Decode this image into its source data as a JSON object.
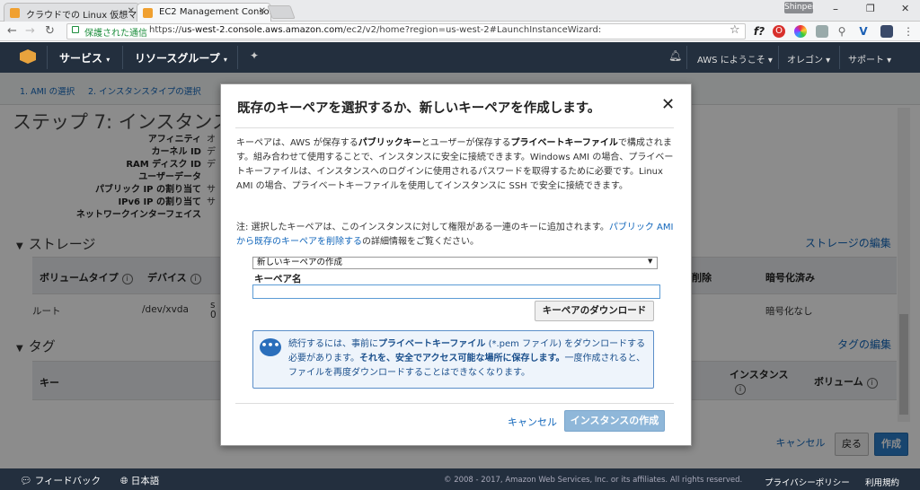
{
  "browser": {
    "tabs": [
      {
        "label": "クラウドでの Linux 仮想マシ"
      },
      {
        "label": "EC2 Management Console"
      }
    ],
    "profile": "Shinpei",
    "window_controls": [
      "–",
      "❐",
      "✕"
    ],
    "secure_label": "保護された通信",
    "url_prefix": "https://",
    "url_host": "us-west-2.console.aws.amazon.com",
    "url_path": "/ec2/v2/home?region=us-west-2#LaunchInstanceWizard:"
  },
  "aws_nav": {
    "services": "サービス",
    "resource_groups": "リソースグループ",
    "account": "AWS にようこそ",
    "region": "オレゴン",
    "support": "サポート"
  },
  "breadcrumbs": [
    "1. AMI の選択",
    "2. インスタンスタイプの選択"
  ],
  "page": {
    "step_title": "ステップ 7: インスタンス作成",
    "properties": [
      {
        "label": "アフィニティ",
        "value": "オ"
      },
      {
        "label": "カーネル ID",
        "value": "デ"
      },
      {
        "label": "RAM ディスク ID",
        "value": "デ"
      },
      {
        "label": "ユーザーデータ",
        "value": ""
      },
      {
        "label": "パブリック IP の割り当て",
        "value": "サ"
      },
      {
        "label": "IPv6 IP の割り当て",
        "value": "サ"
      },
      {
        "label": "ネットワークインターフェイス",
        "value": ""
      }
    ],
    "storage": {
      "heading": "ストレージ",
      "edit": "ストレージの編集",
      "columns": [
        "ボリュームタイプ",
        "デバイス",
        "削除",
        "暗号化済み"
      ],
      "row": {
        "type": "ルート",
        "device": "/dev/xvda",
        "snapshot_a": "s",
        "snapshot_b": "0",
        "encrypted": "暗号化なし"
      }
    },
    "tags": {
      "heading": "タグ",
      "edit": "タグの編集",
      "columns": [
        "キー",
        "インスタンス",
        "ボリューム"
      ]
    },
    "buttons": {
      "cancel": "キャンセル",
      "back": "戻る",
      "launch": "作成"
    }
  },
  "footer": {
    "feedback": "フィードバック",
    "language": "日本語",
    "copyright": "© 2008 - 2017, Amazon Web Services, Inc. or its affiliates. All rights reserved.",
    "privacy": "プライバシーポリシー",
    "terms": "利用規約"
  },
  "modal": {
    "title": "既存のキーペアを選択するか、新しいキーペアを作成します。",
    "p1_a": "キーペアは、AWS が保存する",
    "p1_b": "パブリックキー",
    "p1_c": "とユーザーが保存する",
    "p1_d": "プライベートキーファイル",
    "p1_e": "で構成されます。組み合わせて使用することで、インスタンスに安全に接続できます。Windows AMI の場合、プライベートキーファイルは、インスタンスへのログインに使用されるパスワードを取得するために必要です。Linux AMI の場合、プライベートキーファイルを使用してインスタンスに SSH で安全に接続できます。",
    "p2_a": "注: 選択したキーペアは、このインスタンスに対して権限がある一連のキーに追加されます。",
    "p2_link": "パブリック AMI から既存のキーペアを削除する",
    "p2_b": "の詳細情報をご覧ください。",
    "select_value": "新しいキーペアの作成",
    "keypair_label": "キーペア名",
    "keypair_value": "",
    "download_button": "キーペアのダウンロード",
    "notice_a": "続行するには、事前に",
    "notice_b": "プライベートキーファイル",
    "notice_c": " (*.pem ファイル) をダウンロードする必要があります。",
    "notice_d": "それを、安全でアクセス可能な場所に保存します。",
    "notice_e": "一度作成されると、ファイルを再度ダウンロードすることはできなくなります。",
    "cancel": "キャンセル",
    "launch": "インスタンスの作成"
  }
}
